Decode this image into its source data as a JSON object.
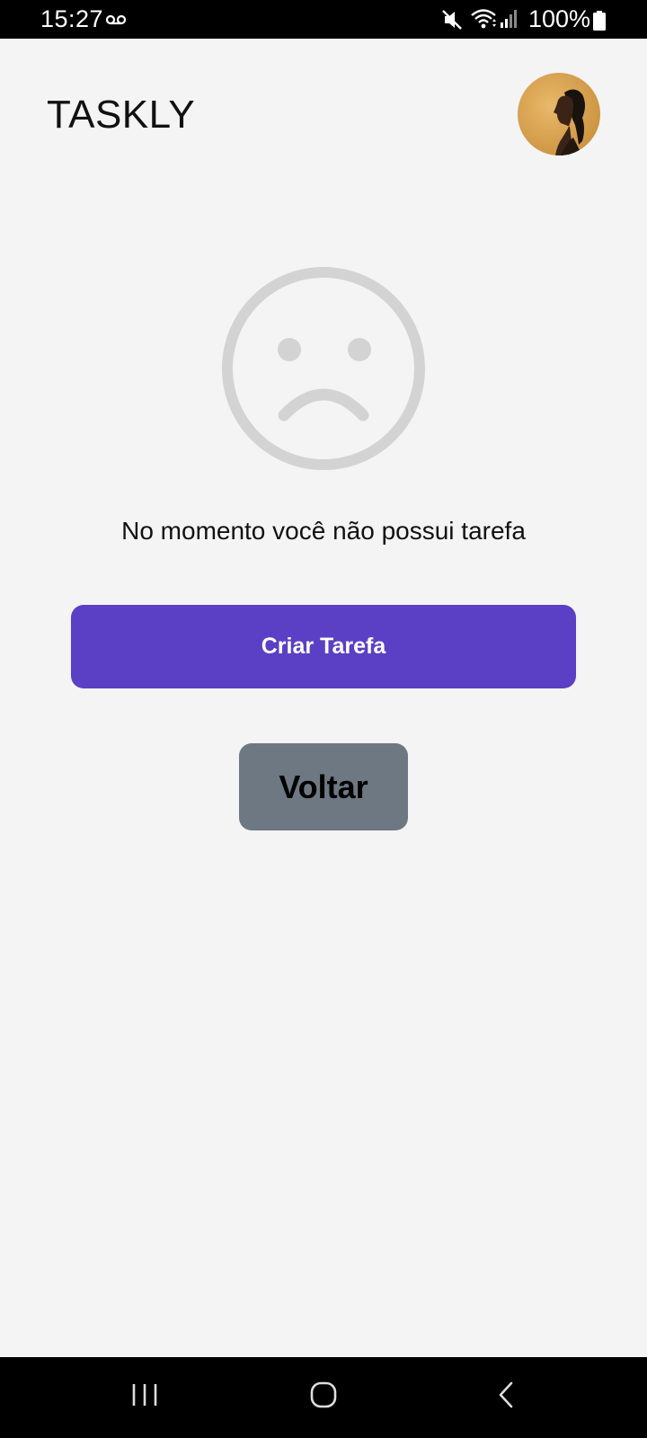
{
  "status_bar": {
    "time": "15:27",
    "battery": "100%",
    "icons": [
      "voicemail-icon",
      "mute-icon",
      "wifi-icon",
      "signal-icon",
      "battery-icon"
    ]
  },
  "header": {
    "title": "TASKLY",
    "avatar": "user-avatar"
  },
  "empty_state": {
    "icon": "sad-face-icon",
    "message": "No momento você não possui tarefa"
  },
  "actions": {
    "create_label": "Criar Tarefa",
    "back_label": "Voltar"
  },
  "nav_bar": {
    "icons": [
      "recents-icon",
      "home-icon",
      "back-icon"
    ]
  },
  "colors": {
    "background": "#f4f4f5",
    "accent": "#5b3fc4",
    "secondary": "#6e7883",
    "icon_gray": "#d3d3d3"
  }
}
